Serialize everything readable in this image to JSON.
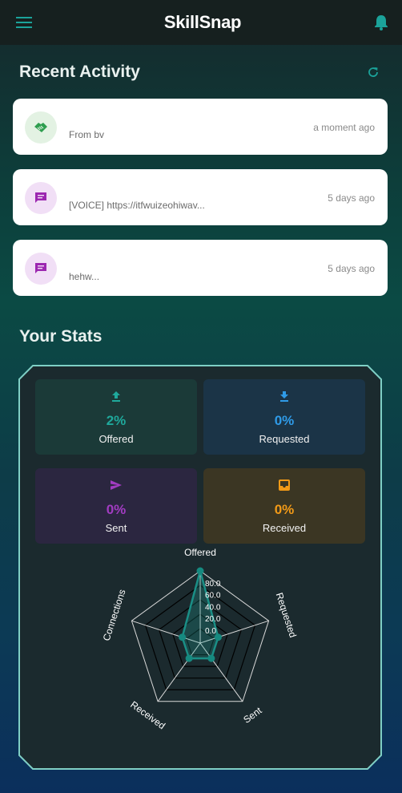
{
  "app": {
    "title": "SkillSnap"
  },
  "icons": {
    "menu": "hamburger-menu-icon",
    "notifications": "bell-icon",
    "refresh": "refresh-icon"
  },
  "colors": {
    "accent": "#1ba39a",
    "offered": "#1fa99c",
    "requested": "#2f9be8",
    "sent": "#a23cc2",
    "received": "#f29a17",
    "white": "#ffffff"
  },
  "recent_activity": {
    "title": "Recent Activity",
    "items": [
      {
        "icon": "handshake-icon",
        "text": "From bv",
        "time": "a moment ago"
      },
      {
        "icon": "message-icon",
        "text": "[VOICE] https://itfwuizeohiwav...",
        "time": "5 days ago"
      },
      {
        "icon": "message-icon",
        "text": "hehw...",
        "time": "5 days ago"
      }
    ]
  },
  "stats": {
    "title": "Your Stats",
    "tiles": [
      {
        "icon": "upload-icon",
        "value": "2%",
        "label": "Offered"
      },
      {
        "icon": "download-icon",
        "value": "0%",
        "label": "Requested"
      },
      {
        "icon": "send-icon",
        "value": "0%",
        "label": "Sent"
      },
      {
        "icon": "inbox-icon",
        "value": "0%",
        "label": "Received"
      }
    ]
  },
  "chart_data": {
    "type": "radar",
    "axes": [
      "Offered",
      "Requested",
      "Sent",
      "Received",
      "Connections"
    ],
    "values": [
      100,
      10,
      10,
      10,
      10
    ],
    "rmax": 100,
    "tick_labels": [
      "0.0",
      "20.0",
      "40.0",
      "60.0",
      "80.0"
    ],
    "tick_values": [
      0,
      20,
      40,
      60,
      80
    ],
    "grid": true
  }
}
